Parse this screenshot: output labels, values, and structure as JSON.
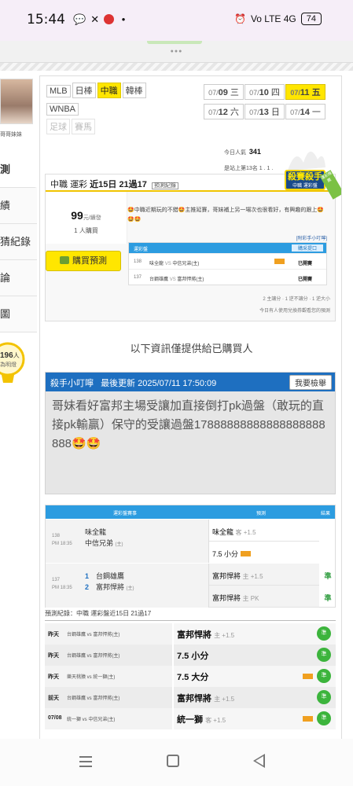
{
  "status": {
    "time": "15:44",
    "signal": "Vo LTE 4G",
    "battery": "74"
  },
  "sidebar": {
    "avatar_name": "哥哥妹妹",
    "items": [
      {
        "label": "測",
        "active": true
      },
      {
        "label": "績"
      },
      {
        "label": "猜紀錄"
      },
      {
        "label": "論"
      },
      {
        "label": "圖"
      }
    ],
    "bulb_count": "196",
    "bulb_count_suffix": "人",
    "bulb_sub": "為明燈"
  },
  "league_tags": [
    {
      "label": "MLB"
    },
    {
      "label": "日棒"
    },
    {
      "label": "中職",
      "active": true
    },
    {
      "label": "韓棒"
    },
    {
      "label": "WNBA"
    },
    {
      "label": "足球",
      "dim": true
    },
    {
      "label": "賽馬",
      "dim": true
    }
  ],
  "dates": [
    {
      "md": "07/",
      "d": "09",
      "wd": "三"
    },
    {
      "md": "07/",
      "d": "10",
      "wd": "四"
    },
    {
      "md": "07/",
      "d": "11",
      "wd": "五",
      "active": true
    },
    {
      "md": "07/",
      "d": "12",
      "wd": "六"
    },
    {
      "md": "07/",
      "d": "13",
      "wd": "日"
    },
    {
      "md": "07/",
      "d": "14",
      "wd": "一"
    }
  ],
  "stats": {
    "today_label": "今日人氣",
    "today_value": "341",
    "rank_label": "是站上第13名",
    "rank_extra": "1 . 1 ."
  },
  "prediction": {
    "league": "中職",
    "type": "運彩",
    "period": "近15日",
    "record": "21過17",
    "record_btn": "預測紀錄",
    "badge": "殺賽殺手",
    "badge_sub": "中職 運彩盤",
    "ribbon": "運彩推薦",
    "price": "99",
    "price_unit": "元/續發",
    "buyers": "1 人購買",
    "buy_btn": "購買預測",
    "message": "🤩中職近期玩的不錯🤩主推延賽，哥妹補上另一場次也很看好，有興趣的跟上🤩🤩🤩",
    "lottery_link": "[附彩手小叮嚀]",
    "lottery_head": "運彩盤",
    "lottery_more": "購采提口",
    "lottery_rows": [
      {
        "id": "138",
        "home": "味全龍",
        "away": "中信兄弟(主)",
        "status": "已開賽"
      },
      {
        "id": "137",
        "home": "台鋼雄鷹",
        "away": "富邦悍將(主)",
        "status": "已開賽"
      }
    ],
    "footer1": "2 主讓分 · 1 逆不讓分 · 1 逆大小",
    "footer2": "今日有人使用兌換券觀看您的預測"
  },
  "notice": "以下資訊僅提供給已購買人",
  "killer": {
    "title": "殺手小叮嚀",
    "updated_label": "最後更新",
    "updated": "2025/07/11 17:50:09",
    "report_btn": "我要檢舉",
    "body": "哥妹看好富邦主場受讓加直接倒打pk過盤（敢玩的直接pk輸贏）保守的受讓過盤17888888888888888888888🤩🤩"
  },
  "games_table": {
    "head_games": "運彩盤賽事",
    "head_pick": "預測",
    "head_result": "結果",
    "rows": [
      {
        "id": "138",
        "time": "PM 18:35",
        "team1": "味全龍",
        "team2": "中信兄弟",
        "team2_tag": "主",
        "picks": [
          {
            "team": "味全龍",
            "side": "客 +1.5",
            "result": ""
          },
          {
            "team": "7.5 小分",
            "side": "",
            "result": ""
          }
        ]
      },
      {
        "id": "137",
        "time": "PM 18:35",
        "team1": "台鋼雄鷹",
        "team2": "富邦悍將",
        "team2_tag": "主",
        "num1": "1",
        "num2": "2",
        "picks": [
          {
            "team": "富邦悍將",
            "side": "主 +1.5",
            "result": "準"
          },
          {
            "team": "富邦悍將",
            "side": "主 PK",
            "result": "準"
          }
        ]
      }
    ]
  },
  "history": {
    "title": "預測紀錄：中職 運彩盤近15日 21過17",
    "rows": [
      {
        "day": "昨天",
        "match": "台鋼雄鷹 vs 富邦悍將(主)",
        "pick": "富邦悍將",
        "side": "主 +1.5",
        "result": "準"
      },
      {
        "day": "昨天",
        "match": "台鋼雄鷹 vs 富邦悍將(主)",
        "pick": "7.5 小分",
        "side": "",
        "result": "準"
      },
      {
        "day": "昨天",
        "match": "樂天桃猿 vs 統一獅(主)",
        "pick": "7.5 大分",
        "side": "",
        "result": "準"
      },
      {
        "day": "前天",
        "match": "台鋼雄鷹 vs 富邦悍將(主)",
        "pick": "富邦悍將",
        "side": "主 +1.5",
        "result": "準"
      },
      {
        "day": "07/08",
        "match": "統一獅 vs 中信兄弟(主)",
        "pick": "統一獅",
        "side": "客 +1.5",
        "result": "準"
      }
    ]
  }
}
